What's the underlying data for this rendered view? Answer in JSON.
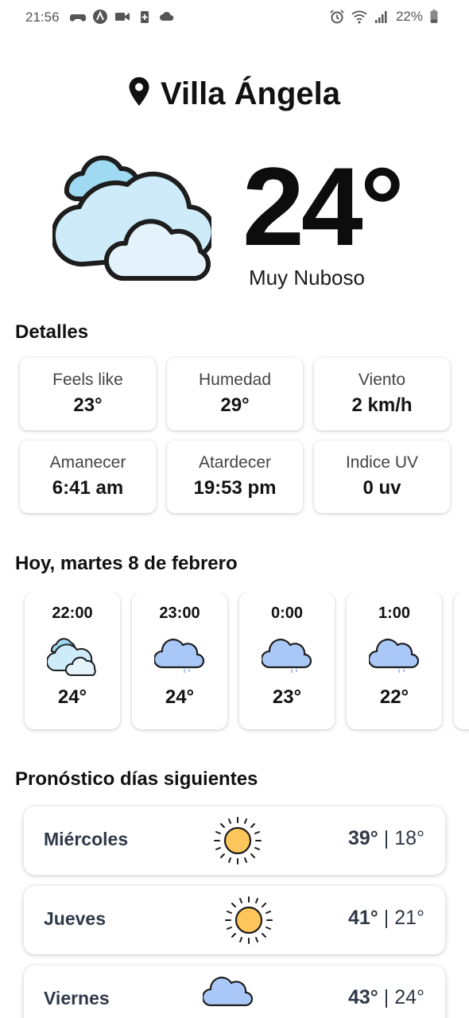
{
  "status_bar": {
    "time": "21:56",
    "battery": "22%"
  },
  "location": "Villa Ángela",
  "current": {
    "temperature": "24°",
    "condition": "Muy Nuboso",
    "icon": "partly-cloudy-icon"
  },
  "details": {
    "title": "Detalles",
    "items": [
      {
        "label": "Feels like",
        "value": "23°"
      },
      {
        "label": "Humedad",
        "value": "29°"
      },
      {
        "label": "Viento",
        "value": "2 km/h"
      },
      {
        "label": "Amanecer",
        "value": "6:41 am"
      },
      {
        "label": "Atardecer",
        "value": "19:53 pm"
      },
      {
        "label": "Indice UV",
        "value": "0 uv"
      }
    ]
  },
  "hourly": {
    "title": "Hoy, martes 8 de febrero",
    "items": [
      {
        "hour": "22:00",
        "temp": "24°",
        "icon": "clouds-icon"
      },
      {
        "hour": "23:00",
        "temp": "24°",
        "icon": "cloud-rain-icon"
      },
      {
        "hour": "0:00",
        "temp": "23°",
        "icon": "cloud-rain-icon"
      },
      {
        "hour": "1:00",
        "temp": "22°",
        "icon": "cloud-rain-icon"
      }
    ]
  },
  "forecast": {
    "title": "Pronóstico días siguientes",
    "items": [
      {
        "day": "Miércoles",
        "high": "39°",
        "separator": "|",
        "low": "18°",
        "icon": "sun-icon"
      },
      {
        "day": "Jueves",
        "high": "41°",
        "separator": "|",
        "low": "21°",
        "icon": "sun-icon"
      },
      {
        "day": "Viernes",
        "high": "43°",
        "separator": "|",
        "low": "24°",
        "icon": "cloud-rain-icon"
      }
    ]
  },
  "colors": {
    "sun": "#FFC65C",
    "cloud_light": "#CDEBF9",
    "cloud_blue": "#A9C8F8",
    "text_dark": "#2f3947"
  }
}
